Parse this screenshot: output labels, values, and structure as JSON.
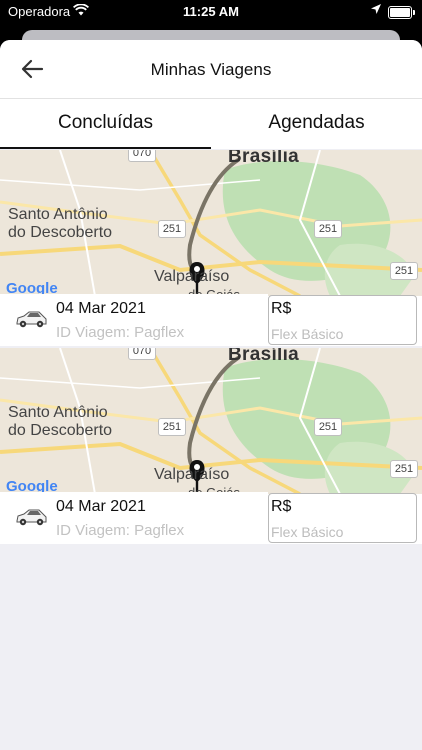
{
  "status_bar": {
    "carrier": "Operadora",
    "time": "11:25 AM"
  },
  "header": {
    "title": "Minhas Viagens"
  },
  "tabs": [
    {
      "label": "Concluídas"
    },
    {
      "label": "Agendadas"
    }
  ],
  "map": {
    "labels": {
      "city": "Brasília",
      "place1_line1": "Santo Antônio",
      "place1_line2": "do Descoberto",
      "place2": "Valparaíso",
      "place2_suffix": "de Goiás",
      "road_070": "070",
      "road_251a": "251",
      "road_251b": "251",
      "road_251c": "251",
      "attribution": "Google"
    }
  },
  "trips": [
    {
      "date": "04 Mar 2021",
      "trip_id": "ID Viagem: Pagflex",
      "price": "R$",
      "category": "Flex Básico"
    },
    {
      "date": "04 Mar 2021",
      "trip_id": "ID Viagem: Pagflex",
      "price": "R$",
      "category": "Flex Básico"
    }
  ],
  "colors": {
    "map_bg": "#ede6da",
    "park_green": "#bfe0b4",
    "major_road": "#f7d87a",
    "route": "#7a7466",
    "pin": "#111111",
    "muted_text": "#c2c2c2"
  }
}
